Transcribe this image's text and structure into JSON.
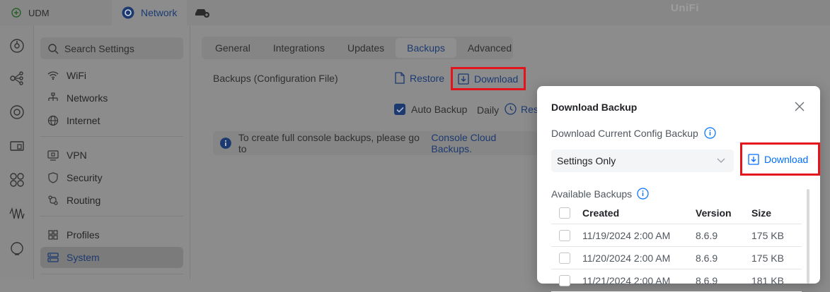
{
  "topbar": {
    "udm_label": "UDM",
    "network_label": "Network",
    "brand": "UniFi"
  },
  "rail": {
    "icons": [
      "dashboard-icon",
      "topology-icon",
      "target-icon",
      "devices-icon",
      "clients-icon",
      "insights-icon",
      "alerts-icon"
    ]
  },
  "nav": {
    "search_placeholder": "Search Settings",
    "items": [
      {
        "label": "WiFi",
        "icon": "wifi-icon"
      },
      {
        "label": "Networks",
        "icon": "networks-icon"
      },
      {
        "label": "Internet",
        "icon": "globe-icon"
      },
      {
        "label": "VPN",
        "icon": "vpn-icon"
      },
      {
        "label": "Security",
        "icon": "shield-icon"
      },
      {
        "label": "Routing",
        "icon": "routing-icon"
      },
      {
        "label": "Profiles",
        "icon": "profiles-icon"
      },
      {
        "label": "System",
        "icon": "system-icon"
      }
    ]
  },
  "main": {
    "tabs": [
      "General",
      "Integrations",
      "Updates",
      "Backups",
      "Advanced"
    ],
    "active_tab": "Backups",
    "backups_label": "Backups (Configuration File)",
    "restore_label": "Restore",
    "download_label": "Download",
    "auto_backup_label": "Auto Backup",
    "auto_backup_checked": true,
    "daily_label": "Daily",
    "reschedule_label": "Res",
    "info_text": "To create full console backups, please go to",
    "info_link": "Console Cloud Backups."
  },
  "modal": {
    "title": "Download Backup",
    "current_label": "Download Current Config Backup",
    "select_value": "Settings Only",
    "download_label": "Download",
    "available_label": "Available Backups",
    "columns": [
      "Created",
      "Version",
      "Size"
    ],
    "rows": [
      {
        "created": "11/19/2024 2:00 AM",
        "version": "8.6.9",
        "size": "175 KB"
      },
      {
        "created": "11/20/2024 2:00 AM",
        "version": "8.6.9",
        "size": "175 KB"
      },
      {
        "created": "11/21/2024 2:00 AM",
        "version": "8.6.9",
        "size": "181 KB"
      }
    ]
  },
  "colors": {
    "accent": "#006fff",
    "highlight_box": "#e3141b",
    "overlay_bg": "#8c8c8c",
    "modal_bg": "#ffffff"
  }
}
